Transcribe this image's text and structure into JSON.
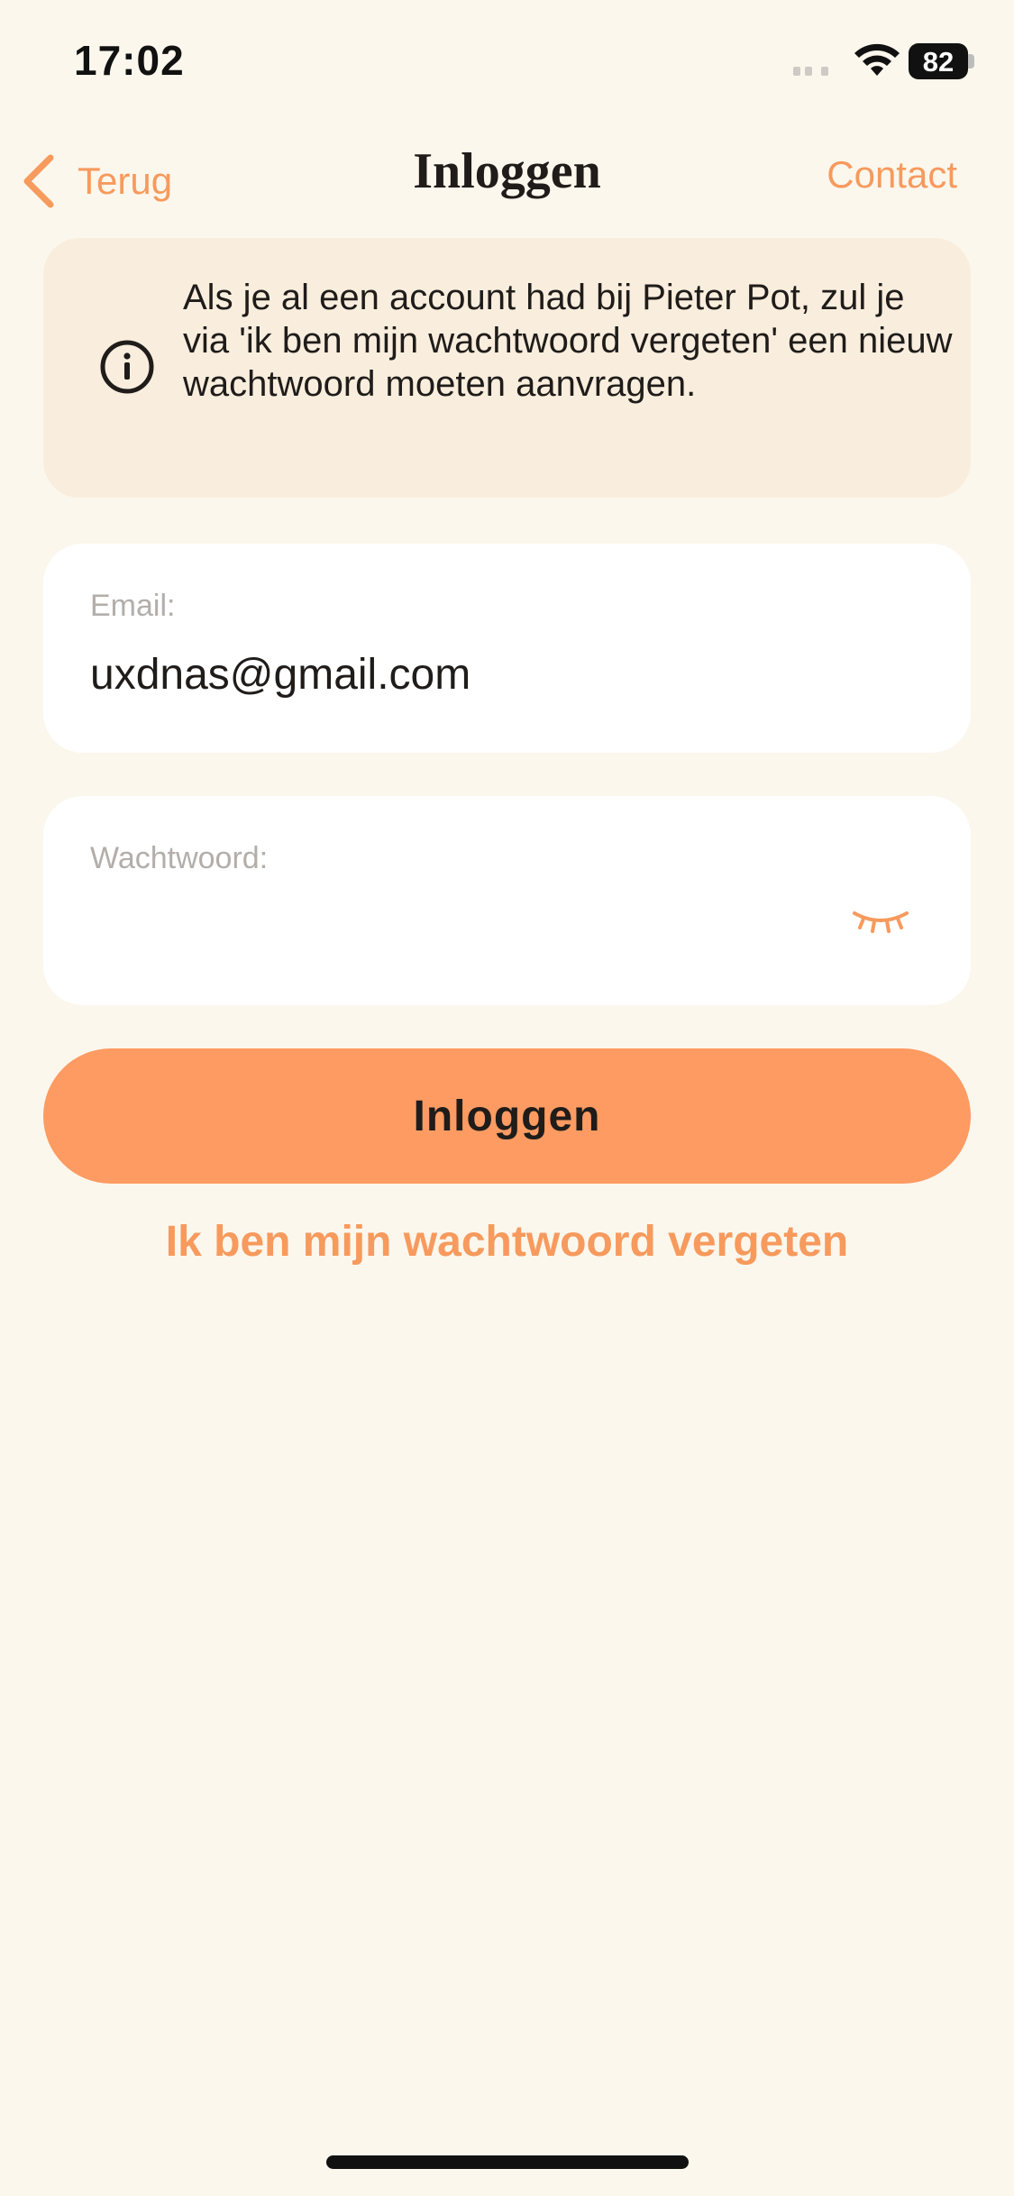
{
  "status_bar": {
    "time": "17:02",
    "battery": "82"
  },
  "nav": {
    "back_label": "Terug",
    "title": "Inloggen",
    "contact_label": "Contact"
  },
  "info_banner": {
    "icon": "info-icon",
    "text": "Als je al een account had bij Pieter Pot, zul je via 'ik ben mijn wachtwoord vergeten' een nieuw wachtwoord moeten aanvragen."
  },
  "form": {
    "email_label": "Email:",
    "email_value": "uxdnas@gmail.com",
    "password_label": "Wachtwoord:",
    "password_value": "",
    "password_toggle_icon": "eye-closed-icon"
  },
  "actions": {
    "login_label": "Inloggen",
    "forgot_password_label": "Ik ben mijn wachtwoord vergeten"
  },
  "colors": {
    "background": "#fcf7ed",
    "accent": "#f79a5d",
    "button": "#fd9b62",
    "banner": "#f9eedd"
  }
}
